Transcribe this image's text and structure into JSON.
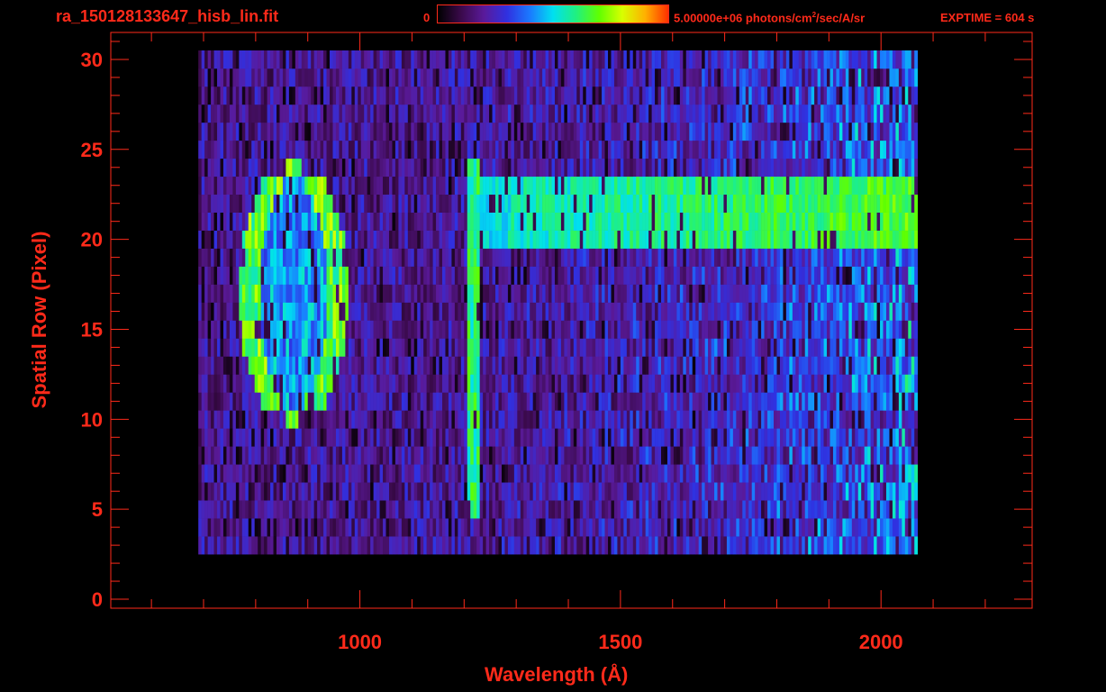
{
  "header": {
    "file_title": "ra_150128133647_hisb_lin.fit",
    "colorbar_min": "0",
    "colorbar_max_value": "5.00000e+06 photons/cm",
    "colorbar_max_exp": "2",
    "colorbar_max_unit": "/sec/A/sr",
    "exptime": "EXPTIME = 604 s"
  },
  "colors": {
    "frame": "#ff2a1a",
    "background": "#000000",
    "colormap": [
      "#000000",
      "#3a0a4a",
      "#5a1a9a",
      "#3030e0",
      "#1a7aff",
      "#00e0f0",
      "#20f080",
      "#60ff00",
      "#d8ff00",
      "#ffb000",
      "#ff3000"
    ]
  },
  "chart_data": {
    "type": "heatmap",
    "title": "",
    "xlabel": "Wavelength (Å)",
    "ylabel": "Spatial Row (Pixel)",
    "xlim": [
      522,
      2290
    ],
    "ylim": [
      -0.5,
      31.5
    ],
    "x_ticks": [
      1000,
      1500,
      2000
    ],
    "y_ticks": [
      0,
      5,
      10,
      15,
      20,
      25,
      30
    ],
    "data_x_range": [
      690,
      2065
    ],
    "data_rows": [
      3,
      30
    ],
    "colorbar_range": [
      0,
      5000000
    ],
    "features": [
      {
        "kind": "emission-arc",
        "rows": [
          10,
          24
        ],
        "x_range": [
          780,
          960
        ]
      },
      {
        "kind": "emission-line",
        "x": 1216,
        "rows": [
          5,
          24
        ]
      },
      {
        "kind": "bright-band",
        "rows": [
          20,
          23
        ],
        "x_range": [
          1216,
          2065
        ]
      }
    ]
  }
}
